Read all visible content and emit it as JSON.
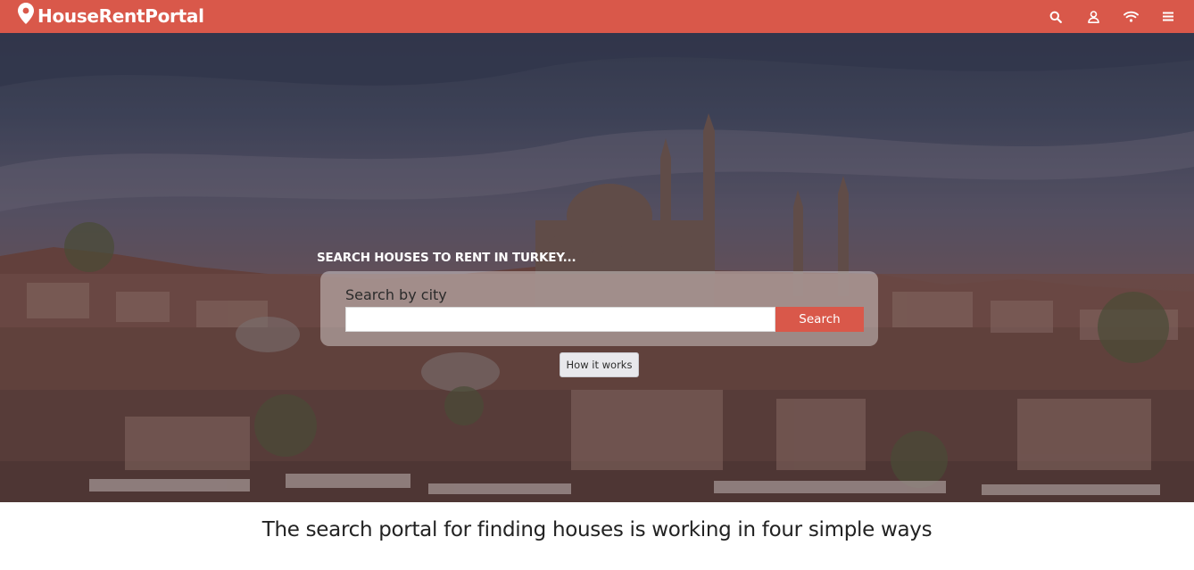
{
  "navbar": {
    "brand": "HouseRentPortal",
    "icons": [
      "location-pin-icon",
      "search-icon",
      "user-icon",
      "wifi-icon",
      "menu-icon"
    ],
    "background_color": "#d9584a"
  },
  "hero": {
    "heading": "SEARCH HOUSES TO RENT IN TURKEY...",
    "search": {
      "label": "Search by city",
      "input_value": "",
      "placeholder": "",
      "button_label": "Search"
    },
    "how_it_works_label": "How it works"
  },
  "section": {
    "heading": "The search portal for finding houses is working in four simple ways"
  }
}
